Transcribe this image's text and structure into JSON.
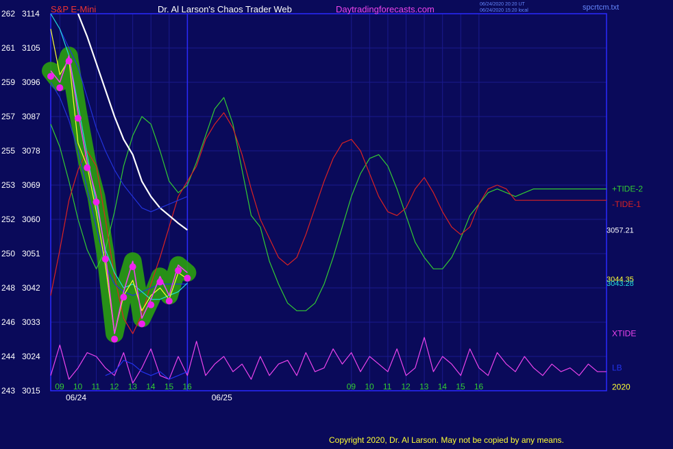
{
  "header": {
    "symbol": "S&P E-Mini",
    "title": "Dr. Al Larson's Chaos Trader Web",
    "site": "Daytradingforecasts.com",
    "stamp_ut": "06/24/2020 20:20 UT",
    "stamp_local": "06/24/2020 15:20 local",
    "file": "spcrtcm.txt"
  },
  "footer": {
    "copyright": "Copyright 2020, Dr. Al Larson. May not be copied by any means."
  },
  "colors": {
    "background": "#0a0a5a",
    "frame": "#2b2bff",
    "grid": "#1a1a8e",
    "price_label": "#ffffff",
    "tide_plus": "#33cc33",
    "tide_minus": "#dd2222",
    "xtide": "#ee44ee",
    "lb": "#2233ee",
    "white_ma": "#ffffff",
    "cyan_ma": "#22dddd",
    "blue_ma": "#2233dd",
    "yellow_ma": "#ffff33",
    "price": "#ee44ee",
    "price_aura": "#2a9e10",
    "energy_dot": "#ee22ee",
    "header_red": "#ee3333",
    "header_site": "#ee44ee",
    "header_stamp": "#6688ff",
    "footer_text": "#ffff33",
    "time_label": "#33cc33",
    "date_label": "#ffffff"
  },
  "chart_data": {
    "type": "line",
    "ylim": [
      3015,
      3114
    ],
    "xlim": [
      8.5,
      39.0
    ],
    "x_unit": "hour",
    "y_ticks": [
      {
        "price": 3114,
        "label": "3114",
        "alt": "262"
      },
      {
        "price": 3105,
        "label": "3105",
        "alt": "261"
      },
      {
        "price": 3096,
        "label": "3096",
        "alt": "259"
      },
      {
        "price": 3087,
        "label": "3087",
        "alt": "257"
      },
      {
        "price": 3078,
        "label": "3078",
        "alt": "255"
      },
      {
        "price": 3069,
        "label": "3069",
        "alt": "253"
      },
      {
        "price": 3060,
        "label": "3060",
        "alt": "252"
      },
      {
        "price": 3051,
        "label": "3051",
        "alt": "250"
      },
      {
        "price": 3042,
        "label": "3042",
        "alt": "248"
      },
      {
        "price": 3033,
        "label": "3033",
        "alt": "246"
      },
      {
        "price": 3024,
        "label": "3024",
        "alt": "244"
      },
      {
        "price": 3015,
        "label": "3015",
        "alt": "243"
      }
    ],
    "x_ticks": [
      {
        "x": 9,
        "label": "09"
      },
      {
        "x": 10,
        "label": "10"
      },
      {
        "x": 11,
        "label": "11"
      },
      {
        "x": 12,
        "label": "12"
      },
      {
        "x": 13,
        "label": "13"
      },
      {
        "x": 14,
        "label": "14"
      },
      {
        "x": 15,
        "label": "15"
      },
      {
        "x": 16,
        "label": "16"
      },
      {
        "x": 25,
        "label": "09"
      },
      {
        "x": 26,
        "label": "10"
      },
      {
        "x": 27,
        "label": "11"
      },
      {
        "x": 28,
        "label": "12"
      },
      {
        "x": 29,
        "label": "13"
      },
      {
        "x": 30,
        "label": "14"
      },
      {
        "x": 31,
        "label": "15"
      },
      {
        "x": 32,
        "label": "16"
      }
    ],
    "date_labels": [
      {
        "x": 8.5,
        "label": "06/24"
      },
      {
        "x": 16.5,
        "label": "06/25"
      }
    ],
    "right_value_labels": [
      {
        "price": 3057.21,
        "label": "3057.21",
        "color": "#ffffff"
      },
      {
        "price": 3044.35,
        "label": "3044.35",
        "color": "#ffff33"
      },
      {
        "price": 3043.28,
        "label": "3043.28",
        "color": "#22dddd"
      }
    ],
    "legend": [
      {
        "label": "+TIDE-2",
        "price": 3068,
        "color": "#33cc33"
      },
      {
        "label": "-TIDE-1",
        "price": 3064,
        "color": "#dd2222"
      },
      {
        "label": "XTIDE",
        "price": 3030,
        "color": "#ee44ee"
      },
      {
        "label": "LB",
        "price": 3021,
        "color": "#2233ee"
      },
      {
        "label": "2020",
        "price": 3016,
        "color": "#ffff33"
      }
    ],
    "series": [
      {
        "name": "+TIDE-2",
        "color": "#33cc33",
        "x": [
          8.5,
          9.0,
          9.5,
          10.0,
          10.5,
          11.0,
          11.5,
          12.0,
          12.5,
          13.0,
          13.5,
          14.0,
          14.5,
          15.0,
          15.5,
          16.0,
          16.5,
          17.0,
          17.5,
          18.0,
          18.5,
          19.0,
          19.5,
          20.0,
          20.5,
          21.0,
          21.5,
          22.0,
          22.5,
          23.0,
          23.5,
          24.0,
          24.5,
          25.0,
          25.5,
          26.0,
          26.5,
          27.0,
          27.5,
          28.0,
          28.5,
          29.0,
          29.5,
          30.0,
          30.5,
          31.0,
          31.5,
          32.0,
          32.5,
          33.0,
          33.5,
          34.0,
          34.5,
          35.0,
          35.5,
          36.0,
          36.5,
          37.0,
          37.5,
          38.0,
          38.5,
          39.0
        ],
        "values": [
          3085,
          3079,
          3070,
          3060,
          3052,
          3047,
          3052,
          3062,
          3074,
          3082,
          3087,
          3085,
          3078,
          3070,
          3067,
          3069,
          3075,
          3082,
          3089,
          3092,
          3085,
          3073,
          3061,
          3058,
          3049,
          3043,
          3038,
          3036,
          3036,
          3038,
          3043,
          3050,
          3058,
          3066,
          3072,
          3076,
          3077,
          3074,
          3068,
          3061,
          3054,
          3050,
          3047,
          3047,
          3050,
          3055,
          3061,
          3064,
          3067,
          3068,
          3067,
          3066,
          3067,
          3068,
          3068,
          3068,
          3068,
          3068,
          3068,
          3068,
          3068,
          3068
        ]
      },
      {
        "name": "-TIDE-1",
        "color": "#dd2222",
        "x": [
          8.5,
          9.0,
          9.5,
          10.0,
          10.5,
          11.0,
          11.5,
          12.0,
          12.5,
          13.0,
          13.5,
          14.0,
          14.5,
          15.0,
          15.5,
          16.0,
          16.5,
          17.0,
          17.5,
          18.0,
          18.5,
          19.0,
          19.5,
          20.0,
          20.5,
          21.0,
          21.5,
          22.0,
          22.5,
          23.0,
          23.5,
          24.0,
          24.5,
          25.0,
          25.5,
          26.0,
          26.5,
          27.0,
          27.5,
          28.0,
          28.5,
          29.0,
          29.5,
          30.0,
          30.5,
          31.0,
          31.5,
          32.0,
          32.5,
          33.0,
          33.5,
          34.0,
          34.5,
          35.0,
          35.5,
          36.0,
          36.5,
          37.0,
          37.5,
          38.0,
          38.5,
          39.0
        ],
        "values": [
          3040,
          3052,
          3065,
          3073,
          3078,
          3074,
          3060,
          3045,
          3034,
          3030,
          3035,
          3043,
          3050,
          3058,
          3066,
          3070,
          3074,
          3081,
          3085,
          3088,
          3084,
          3077,
          3068,
          3060,
          3055,
          3050,
          3048,
          3050,
          3056,
          3063,
          3070,
          3076,
          3080,
          3081,
          3078,
          3072,
          3066,
          3062,
          3061,
          3063,
          3068,
          3071,
          3067,
          3062,
          3058,
          3056,
          3058,
          3064,
          3068,
          3069,
          3068,
          3065,
          3065,
          3065,
          3065,
          3065,
          3065,
          3065,
          3065,
          3065,
          3065,
          3065
        ]
      },
      {
        "name": "XTIDE",
        "color": "#ee44ee",
        "x": [
          8.5,
          9.0,
          9.5,
          10.0,
          10.5,
          11.0,
          11.5,
          12.0,
          12.5,
          13.0,
          13.5,
          14.0,
          14.5,
          15.0,
          15.5,
          16.0,
          16.5,
          17.0,
          17.5,
          18.0,
          18.5,
          19.0,
          19.5,
          20.0,
          20.5,
          21.0,
          21.5,
          22.0,
          22.5,
          23.0,
          23.5,
          24.0,
          24.5,
          25.0,
          25.5,
          26.0,
          26.5,
          27.0,
          27.5,
          28.0,
          28.5,
          29.0,
          29.5,
          30.0,
          30.5,
          31.0,
          31.5,
          32.0,
          32.5,
          33.0,
          33.5,
          34.0,
          34.5,
          35.0,
          35.5,
          36.0,
          36.5,
          37.0,
          37.5,
          38.0,
          38.5,
          39.0
        ],
        "values": [
          3019,
          3027,
          3018,
          3021,
          3025,
          3024,
          3021,
          3019,
          3025,
          3017,
          3021,
          3026,
          3019,
          3018,
          3024,
          3019,
          3028,
          3019,
          3022,
          3024,
          3020,
          3022,
          3018,
          3024,
          3019,
          3022,
          3023,
          3019,
          3025,
          3020,
          3021,
          3026,
          3022,
          3025,
          3020,
          3024,
          3022,
          3020,
          3026,
          3019,
          3021,
          3029,
          3020,
          3024,
          3022,
          3019,
          3026,
          3021,
          3019,
          3025,
          3022,
          3020,
          3024,
          3021,
          3019,
          3022,
          3020,
          3021,
          3019,
          3022,
          3020,
          3020
        ]
      },
      {
        "name": "LB",
        "color": "#2233ee",
        "x": [
          11.5,
          12.0,
          12.5,
          13.0,
          13.5,
          14.0,
          14.5,
          15.0,
          15.5,
          16.0
        ],
        "values": [
          3019,
          3020,
          3023,
          3022,
          3020,
          3019,
          3020,
          3018,
          3019,
          3020
        ]
      },
      {
        "name": "white-ma",
        "color": "#ffffff",
        "x": [
          10.0,
          10.5,
          11.0,
          11.5,
          12.0,
          12.5,
          13.0,
          13.5,
          14.0,
          14.5,
          15.0,
          15.5,
          16.0
        ],
        "values": [
          3114,
          3108,
          3101,
          3094,
          3087,
          3081,
          3077,
          3070,
          3066,
          3063,
          3061,
          3059,
          3057.21
        ]
      },
      {
        "name": "blue-ma-upper",
        "color": "#2233dd",
        "x": [
          9.0,
          9.5,
          10.0,
          10.5,
          11.0,
          11.5,
          12.0,
          12.5,
          13.0,
          13.5,
          14.0,
          14.5,
          15.0,
          15.5,
          16.0
        ],
        "values": [
          3110,
          3105,
          3100,
          3092,
          3084,
          3078,
          3073,
          3069,
          3066,
          3063,
          3062,
          3063,
          3064,
          3065,
          3066
        ]
      },
      {
        "name": "blue-ma-lower",
        "color": "#2233dd",
        "x": [
          8.5,
          9.0,
          9.5,
          10.0,
          10.5,
          11.0,
          11.5,
          12.0,
          12.5,
          13.0,
          13.5,
          14.0,
          14.5,
          15.0,
          15.5,
          16.0
        ],
        "values": [
          3096,
          3092,
          3086,
          3078,
          3068,
          3058,
          3048,
          3043,
          3041,
          3040,
          3041,
          3042,
          3043,
          3043,
          3043,
          3043
        ]
      },
      {
        "name": "cyan-ma",
        "color": "#22dddd",
        "x": [
          8.5,
          9.0,
          9.5,
          10.0,
          10.5,
          11.0,
          11.5,
          12.0,
          12.5,
          13.0,
          13.5,
          14.0,
          14.5,
          15.0,
          15.5,
          16.0
        ],
        "values": [
          3114,
          3110,
          3103,
          3090,
          3077,
          3064,
          3052,
          3046,
          3042,
          3043,
          3041,
          3039,
          3039,
          3040,
          3041,
          3043.28
        ]
      },
      {
        "name": "yellow-ma",
        "color": "#ffff33",
        "x": [
          8.5,
          9.0,
          9.5,
          10.0,
          10.5,
          11.0,
          11.5,
          12.0,
          12.5,
          13.0,
          13.5,
          14.0,
          14.5,
          15.0,
          15.5,
          16.0
        ],
        "values": [
          3110,
          3098,
          3102,
          3080,
          3074,
          3062,
          3048,
          3030,
          3040,
          3044,
          3036,
          3040,
          3042,
          3039,
          3046,
          3044.35
        ]
      },
      {
        "name": "price",
        "color": "#ee44ee",
        "x": [
          8.5,
          9.0,
          9.5,
          10.0,
          10.5,
          11.0,
          11.5,
          12.0,
          12.5,
          13.0,
          13.5,
          14.0,
          14.5,
          15.0,
          15.5,
          16.0
        ],
        "values": [
          3099,
          3096,
          3103,
          3088,
          3075,
          3066,
          3051,
          3030,
          3041,
          3049,
          3034,
          3039,
          3045,
          3040,
          3048,
          3046
        ]
      }
    ]
  }
}
